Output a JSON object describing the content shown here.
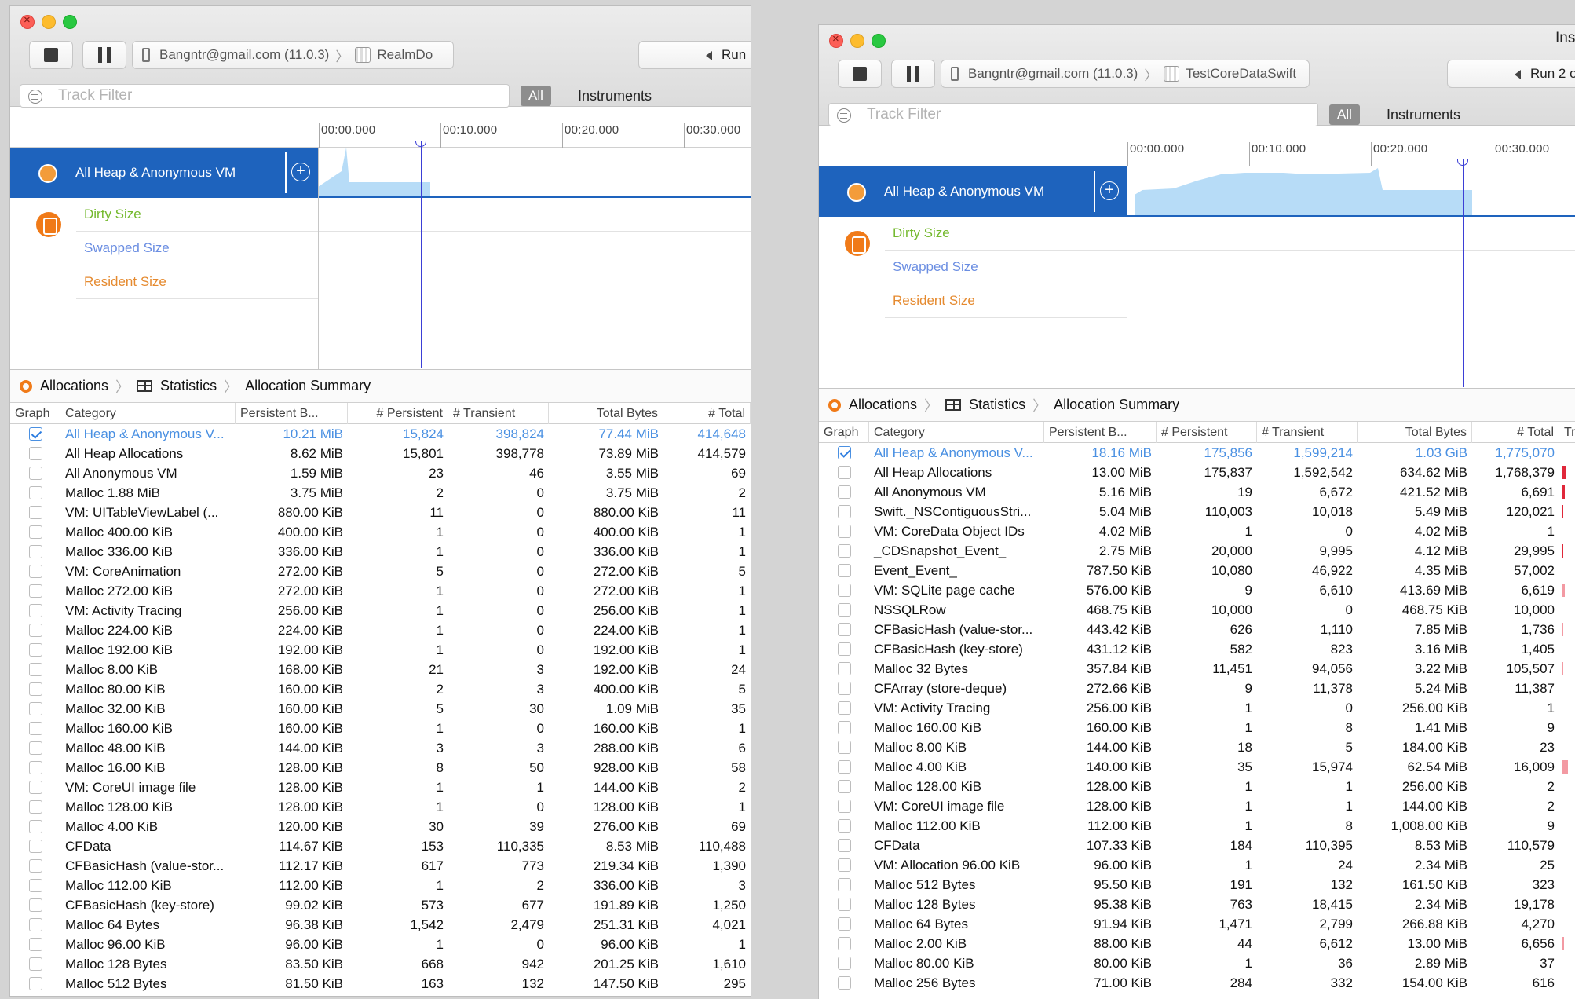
{
  "left_window": {
    "scheme_device": "Bangntr@gmail.com (11.0.3)",
    "scheme_app": "RealmDo",
    "run_label": "Run",
    "filter_placeholder": "Track Filter",
    "all_label": "All",
    "instruments_label": "Instruments",
    "ticks": [
      "00:00.000",
      "00:10.000",
      "00:20.000",
      "00:30.000"
    ],
    "track_name": "All Heap & Anonymous VM",
    "sub_tracks": [
      "Dirty Size",
      "Swapped Size",
      "Resident Size"
    ],
    "breadcrumb": [
      "Allocations",
      "Statistics",
      "Allocation Summary"
    ],
    "columns": [
      "Graph",
      "Category",
      "Persistent B...",
      "# Persistent",
      "# Transient",
      "Total Bytes",
      "# Total"
    ],
    "rows": [
      [
        "All Heap & Anonymous V...",
        "10.21 MiB",
        "15,824",
        "398,824",
        "77.44 MiB",
        "414,648"
      ],
      [
        "All Heap Allocations",
        "8.62 MiB",
        "15,801",
        "398,778",
        "73.89 MiB",
        "414,579"
      ],
      [
        "All Anonymous VM",
        "1.59 MiB",
        "23",
        "46",
        "3.55 MiB",
        "69"
      ],
      [
        "Malloc 1.88 MiB",
        "3.75 MiB",
        "2",
        "0",
        "3.75 MiB",
        "2"
      ],
      [
        "VM: UITableViewLabel (...",
        "880.00 KiB",
        "11",
        "0",
        "880.00 KiB",
        "11"
      ],
      [
        "Malloc 400.00 KiB",
        "400.00 KiB",
        "1",
        "0",
        "400.00 KiB",
        "1"
      ],
      [
        "Malloc 336.00 KiB",
        "336.00 KiB",
        "1",
        "0",
        "336.00 KiB",
        "1"
      ],
      [
        "VM: CoreAnimation",
        "272.00 KiB",
        "5",
        "0",
        "272.00 KiB",
        "5"
      ],
      [
        "Malloc 272.00 KiB",
        "272.00 KiB",
        "1",
        "0",
        "272.00 KiB",
        "1"
      ],
      [
        "VM: Activity Tracing",
        "256.00 KiB",
        "1",
        "0",
        "256.00 KiB",
        "1"
      ],
      [
        "Malloc 224.00 KiB",
        "224.00 KiB",
        "1",
        "0",
        "224.00 KiB",
        "1"
      ],
      [
        "Malloc 192.00 KiB",
        "192.00 KiB",
        "1",
        "0",
        "192.00 KiB",
        "1"
      ],
      [
        "Malloc 8.00 KiB",
        "168.00 KiB",
        "21",
        "3",
        "192.00 KiB",
        "24"
      ],
      [
        "Malloc 80.00 KiB",
        "160.00 KiB",
        "2",
        "3",
        "400.00 KiB",
        "5"
      ],
      [
        "Malloc 32.00 KiB",
        "160.00 KiB",
        "5",
        "30",
        "1.09 MiB",
        "35"
      ],
      [
        "Malloc 160.00 KiB",
        "160.00 KiB",
        "1",
        "0",
        "160.00 KiB",
        "1"
      ],
      [
        "Malloc 48.00 KiB",
        "144.00 KiB",
        "3",
        "3",
        "288.00 KiB",
        "6"
      ],
      [
        "Malloc 16.00 KiB",
        "128.00 KiB",
        "8",
        "50",
        "928.00 KiB",
        "58"
      ],
      [
        "VM: CoreUI image file",
        "128.00 KiB",
        "1",
        "1",
        "144.00 KiB",
        "2"
      ],
      [
        "Malloc 128.00 KiB",
        "128.00 KiB",
        "1",
        "0",
        "128.00 KiB",
        "1"
      ],
      [
        "Malloc 4.00 KiB",
        "120.00 KiB",
        "30",
        "39",
        "276.00 KiB",
        "69"
      ],
      [
        "CFData",
        "114.67 KiB",
        "153",
        "110,335",
        "8.53 MiB",
        "110,488"
      ],
      [
        "CFBasicHash (value-stor...",
        "112.17 KiB",
        "617",
        "773",
        "219.34 KiB",
        "1,390"
      ],
      [
        "Malloc 112.00 KiB",
        "112.00 KiB",
        "1",
        "2",
        "336.00 KiB",
        "3"
      ],
      [
        "CFBasicHash (key-store)",
        "99.02 KiB",
        "573",
        "677",
        "191.89 KiB",
        "1,250"
      ],
      [
        "Malloc 64 Bytes",
        "96.38 KiB",
        "1,542",
        "2,479",
        "251.31 KiB",
        "4,021"
      ],
      [
        "Malloc 96.00 KiB",
        "96.00 KiB",
        "1",
        "0",
        "96.00 KiB",
        "1"
      ],
      [
        "Malloc 128 Bytes",
        "83.50 KiB",
        "668",
        "942",
        "201.25 KiB",
        "1,610"
      ],
      [
        "Malloc 512 Bytes",
        "81.50 KiB",
        "163",
        "132",
        "147.50 KiB",
        "295"
      ]
    ]
  },
  "right_window": {
    "title_partial": "Ins",
    "scheme_device": "Bangntr@gmail.com (11.0.3)",
    "scheme_app": "TestCoreDataSwift",
    "run_label": "Run 2 o",
    "filter_placeholder": "Track Filter",
    "all_label": "All",
    "instruments_label": "Instruments",
    "ticks": [
      "00:00.000",
      "00:10.000",
      "00:20.000",
      "00:30.000"
    ],
    "track_name": "All Heap & Anonymous VM",
    "sub_tracks": [
      "Dirty Size",
      "Swapped Size",
      "Resident Size"
    ],
    "breadcrumb": [
      "Allocations",
      "Statistics",
      "Allocation Summary"
    ],
    "columns": [
      "Graph",
      "Category",
      "Persistent B...",
      "# Persistent",
      "# Transient",
      "Total Bytes",
      "# Total",
      "Tr"
    ],
    "rows": [
      [
        "All Heap & Anonymous V...",
        "18.16 MiB",
        "175,856",
        "1,599,214",
        "1.03 GiB",
        "1,775,070"
      ],
      [
        "All Heap Allocations",
        "13.00 MiB",
        "175,837",
        "1,592,542",
        "634.62 MiB",
        "1,768,379"
      ],
      [
        "All Anonymous VM",
        "5.16 MiB",
        "19",
        "6,672",
        "421.52 MiB",
        "6,691"
      ],
      [
        "Swift._NSContiguousStri...",
        "5.04 MiB",
        "110,003",
        "10,018",
        "5.49 MiB",
        "120,021"
      ],
      [
        "VM: CoreData Object IDs",
        "4.02 MiB",
        "1",
        "0",
        "4.02 MiB",
        "1"
      ],
      [
        "_CDSnapshot_Event_",
        "2.75 MiB",
        "20,000",
        "9,995",
        "4.12 MiB",
        "29,995"
      ],
      [
        "Event_Event_",
        "787.50 KiB",
        "10,080",
        "46,922",
        "4.35 MiB",
        "57,002"
      ],
      [
        "VM: SQLite page cache",
        "576.00 KiB",
        "9",
        "6,610",
        "413.69 MiB",
        "6,619"
      ],
      [
        "NSSQLRow",
        "468.75 KiB",
        "10,000",
        "0",
        "468.75 KiB",
        "10,000"
      ],
      [
        "CFBasicHash (value-stor...",
        "443.42 KiB",
        "626",
        "1,110",
        "7.85 MiB",
        "1,736"
      ],
      [
        "CFBasicHash (key-store)",
        "431.12 KiB",
        "582",
        "823",
        "3.16 MiB",
        "1,405"
      ],
      [
        "Malloc 32 Bytes",
        "357.84 KiB",
        "11,451",
        "94,056",
        "3.22 MiB",
        "105,507"
      ],
      [
        "CFArray (store-deque)",
        "272.66 KiB",
        "9",
        "11,378",
        "5.24 MiB",
        "11,387"
      ],
      [
        "VM: Activity Tracing",
        "256.00 KiB",
        "1",
        "0",
        "256.00 KiB",
        "1"
      ],
      [
        "Malloc 160.00 KiB",
        "160.00 KiB",
        "1",
        "8",
        "1.41 MiB",
        "9"
      ],
      [
        "Malloc 8.00 KiB",
        "144.00 KiB",
        "18",
        "5",
        "184.00 KiB",
        "23"
      ],
      [
        "Malloc 4.00 KiB",
        "140.00 KiB",
        "35",
        "15,974",
        "62.54 MiB",
        "16,009"
      ],
      [
        "Malloc 128.00 KiB",
        "128.00 KiB",
        "1",
        "1",
        "256.00 KiB",
        "2"
      ],
      [
        "VM: CoreUI image file",
        "128.00 KiB",
        "1",
        "1",
        "144.00 KiB",
        "2"
      ],
      [
        "Malloc 112.00 KiB",
        "112.00 KiB",
        "1",
        "8",
        "1,008.00 KiB",
        "9"
      ],
      [
        "CFData",
        "107.33 KiB",
        "184",
        "110,395",
        "8.53 MiB",
        "110,579"
      ],
      [
        "VM: Allocation 96.00 KiB",
        "96.00 KiB",
        "1",
        "24",
        "2.34 MiB",
        "25"
      ],
      [
        "Malloc 512 Bytes",
        "95.50 KiB",
        "191",
        "132",
        "161.50 KiB",
        "323"
      ],
      [
        "Malloc 128 Bytes",
        "95.38 KiB",
        "763",
        "18,415",
        "2.34 MiB",
        "19,178"
      ],
      [
        "Malloc 64 Bytes",
        "91.94 KiB",
        "1,471",
        "2,799",
        "266.88 KiB",
        "4,270"
      ],
      [
        "Malloc 2.00 KiB",
        "88.00 KiB",
        "44",
        "6,612",
        "13.00 MiB",
        "6,656"
      ],
      [
        "Malloc 80.00 KiB",
        "80.00 KiB",
        "1",
        "36",
        "2.89 MiB",
        "37"
      ],
      [
        "Malloc 256 Bytes",
        "71.00 KiB",
        "284",
        "332",
        "154.00 KiB",
        "616"
      ]
    ]
  }
}
